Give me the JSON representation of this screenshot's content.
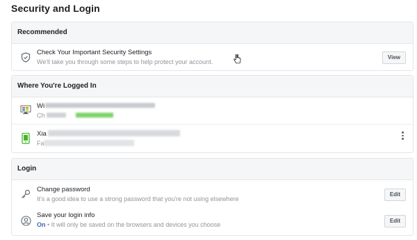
{
  "page": {
    "title": "Security and Login"
  },
  "recommended": {
    "header": "Recommended",
    "item": {
      "title": "Check Your Important Security Settings",
      "subtitle": "We'll take you through some steps to help protect your account.",
      "button": "View",
      "icon": "shield-icon"
    }
  },
  "logged_in": {
    "header": "Where You're Logged In",
    "sessions": [
      {
        "device": "Wi",
        "detail": "Ch",
        "icon": "desktop-icon"
      },
      {
        "device": "Xia",
        "detail": "Fa",
        "icon": "mobile-phone-icon"
      }
    ]
  },
  "login": {
    "header": "Login",
    "items": [
      {
        "title": "Change password",
        "subtitle": "It's a good idea to use a strong password that you're not using elsewhere",
        "button": "Edit",
        "icon": "key-icon"
      },
      {
        "title": "Save your login info",
        "status": "On",
        "subtitle": " • It will only be saved on the browsers and devices you choose",
        "button": "Edit",
        "icon": "user-circle-icon"
      }
    ]
  },
  "colors": {
    "accent": "#4267b2",
    "online_green": "#42b72a",
    "header_bg": "#f5f6f7"
  }
}
